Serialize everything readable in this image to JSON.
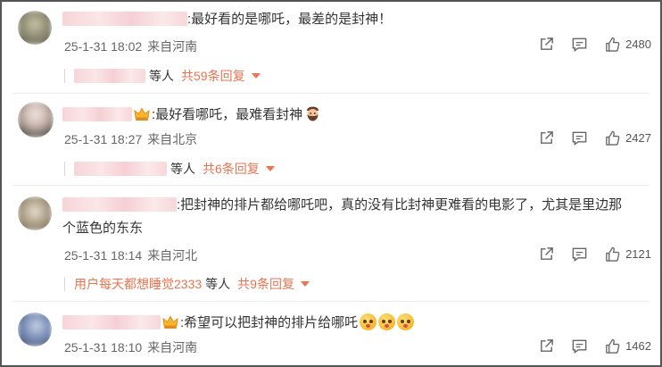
{
  "comments": [
    {
      "text": ":最好看的是哪吒，最差的是封神！",
      "meta": {
        "date": "25-1-31 18:02",
        "location": "来自河南"
      },
      "likes": "2480",
      "replies": {
        "suffix": "等人",
        "count_label": "共59条回复"
      }
    },
    {
      "text": ":最好看哪吒，最难看封神",
      "meta": {
        "date": "25-1-31 18:27",
        "location": "来自北京"
      },
      "likes": "2427",
      "replies": {
        "suffix": "等人",
        "count_label": "共6条回复"
      }
    },
    {
      "text_line1": ":把封神的排片都给哪吒吧，真的没有比封神更难看的电影了，尤其是里边那",
      "text_line2": "个蓝色的东东",
      "meta": {
        "date": "25-1-31 18:14",
        "location": "来自河北"
      },
      "likes": "2121",
      "replies": {
        "user": "用户每天都想睡觉2333",
        "suffix": "等人",
        "count_label": "共9条回复"
      }
    },
    {
      "text": ":希望可以把封神的排片给哪吒",
      "meta": {
        "date": "25-1-31 18:10",
        "location": "来自河南"
      },
      "likes": "1462"
    }
  ],
  "icons": {
    "share": "share-icon",
    "comment": "comment-icon",
    "like": "thumbs-up-icon",
    "badge": "crown-badge-icon",
    "emoji": "drooling-emoji-icon",
    "face": "bearded-face-emoji-icon",
    "dropdown": "caret-down-icon"
  },
  "colors": {
    "accent": "#eb7350",
    "meta": "#666666",
    "text": "#333333"
  }
}
